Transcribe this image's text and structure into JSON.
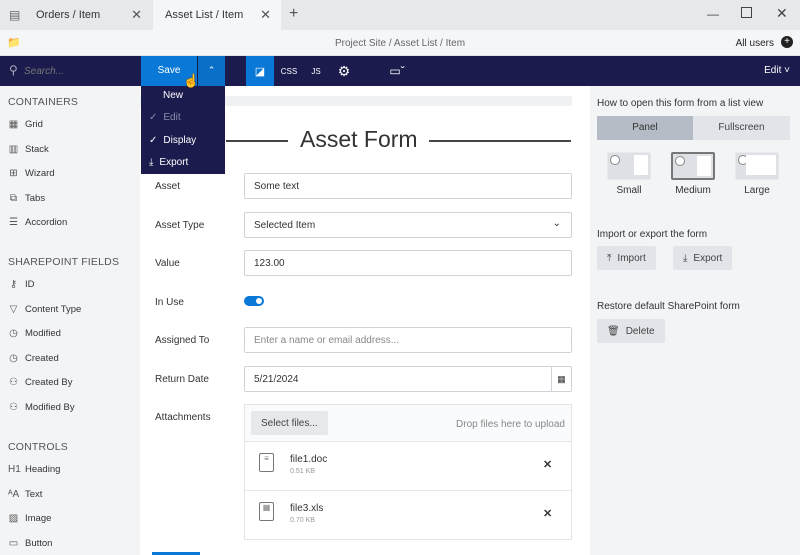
{
  "tabs": [
    {
      "label": "Orders / Item",
      "active": false
    },
    {
      "label": "Asset List / Item",
      "active": true
    }
  ],
  "window": {
    "breadcrumb": "Project Site / Asset List / Item",
    "users": "All users"
  },
  "toolbar": {
    "search_placeholder": "Search...",
    "save": "Save",
    "edit": "Edit",
    "accent": "#0a78d7"
  },
  "save_menu": [
    {
      "label": "New",
      "checked": false,
      "disabled": false
    },
    {
      "label": "Edit",
      "checked": true,
      "disabled": true
    },
    {
      "label": "Display",
      "checked": true,
      "disabled": false
    },
    {
      "label": "Export",
      "icon": "download-icon"
    }
  ],
  "sidebar": {
    "containers_title": "CONTAINERS",
    "containers": [
      {
        "label": "Grid",
        "icon": "grid-icon"
      },
      {
        "label": "Stack",
        "icon": "stack-icon"
      },
      {
        "label": "Wizard",
        "icon": "wizard-icon"
      },
      {
        "label": "Tabs",
        "icon": "tabs-icon"
      },
      {
        "label": "Accordion",
        "icon": "accordion-icon"
      }
    ],
    "fields_title": "SHAREPOINT FIELDS",
    "fields": [
      {
        "label": "ID",
        "icon": "key-icon"
      },
      {
        "label": "Content Type",
        "icon": "filter-icon"
      },
      {
        "label": "Modified",
        "icon": "clock-icon"
      },
      {
        "label": "Created",
        "icon": "clock-icon"
      },
      {
        "label": "Created By",
        "icon": "people-icon"
      },
      {
        "label": "Modified By",
        "icon": "people-icon"
      }
    ],
    "controls_title": "CONTROLS",
    "controls": [
      {
        "label": "Heading",
        "icon": "h1-icon"
      },
      {
        "label": "Text",
        "icon": "text-icon"
      },
      {
        "label": "Image",
        "icon": "image-icon"
      },
      {
        "label": "Button",
        "icon": "button-icon"
      }
    ]
  },
  "form": {
    "title": "Asset Form",
    "asset_label": "Asset",
    "asset_value": "Some text",
    "type_label": "Asset Type",
    "type_value": "Selected Item",
    "value_label": "Value",
    "value_value": "123.00",
    "inuse_label": "In Use",
    "inuse_on": true,
    "assigned_label": "Assigned To",
    "assigned_placeholder": "Enter a name or email address...",
    "date_label": "Return Date",
    "date_value": "5/21/2024",
    "attach_label": "Attachments",
    "select_files": "Select files...",
    "drop_text": "Drop files here to upload",
    "files": [
      {
        "name": "file1.doc",
        "size": "0.51 KB",
        "icon": "document-icon"
      },
      {
        "name": "file3.xls",
        "size": "0.70 KB",
        "icon": "spreadsheet-icon"
      }
    ]
  },
  "right": {
    "open_title": "How to open this form from a list view",
    "panel": "Panel",
    "fullscreen": "Fullscreen",
    "selected_mode": "Panel",
    "sizes": [
      "Small",
      "Medium",
      "Large"
    ],
    "selected_size": "Medium",
    "ie_title": "Import or export the form",
    "import": "Import",
    "export": "Export",
    "restore_title": "Restore default SharePoint form",
    "delete": "Delete"
  }
}
